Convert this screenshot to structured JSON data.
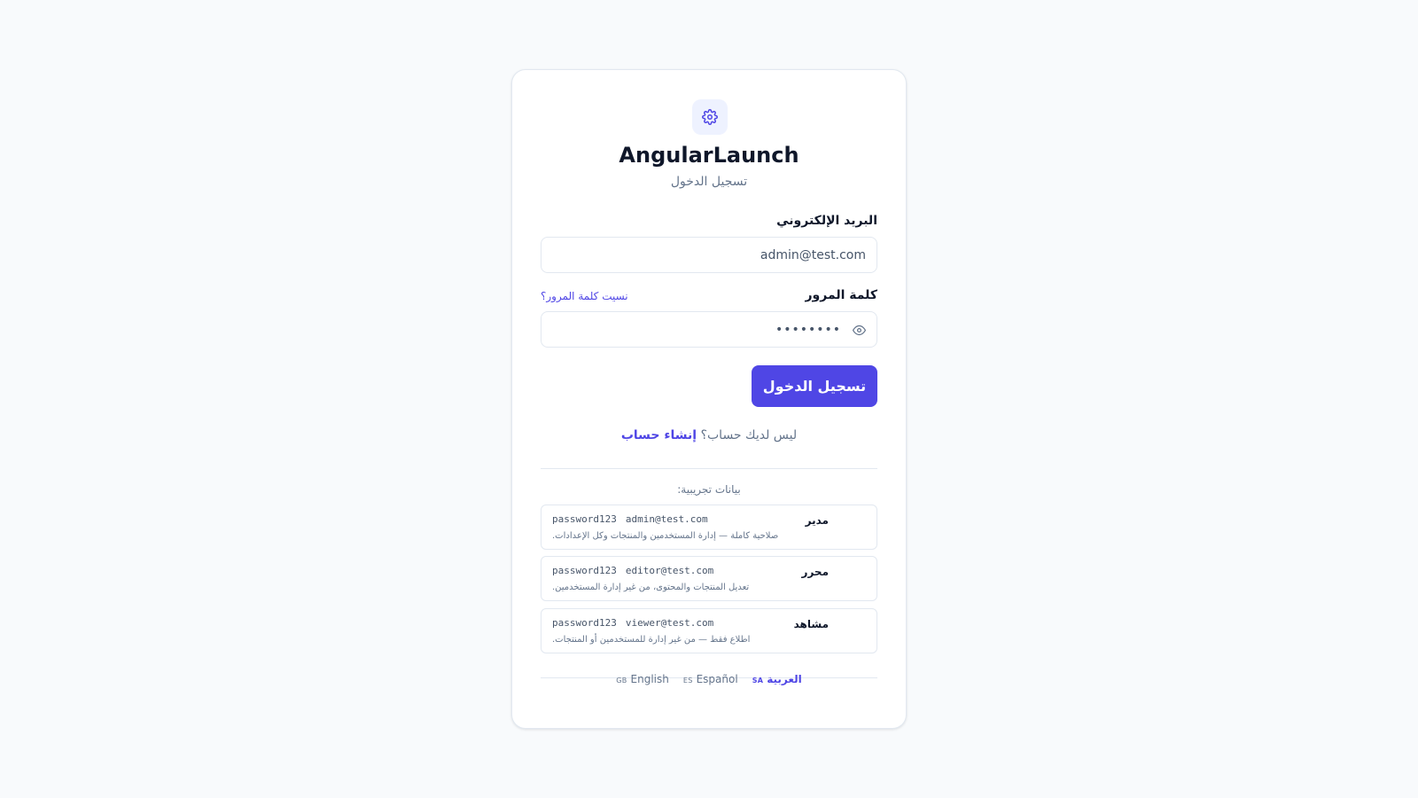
{
  "app": {
    "title": "AngularLaunch",
    "subtitle": "تسجيل الدخول",
    "logo_icon": "gear-icon",
    "accent_color": "#4f46e5"
  },
  "form": {
    "email_label": "البريد الإلكتروني",
    "email_value": "admin@test.com",
    "password_label": "كلمة المرور",
    "password_value": "password",
    "forgot_link": "نسيت كلمة المرور؟",
    "submit_label": "تسجيل الدخول"
  },
  "signup": {
    "prompt": "ليس لديك حساب؟",
    "link": "إنشاء حساب"
  },
  "demo": {
    "title": "بيانات تجريبية:",
    "accounts": [
      {
        "role": "مدير",
        "email": "admin@test.com",
        "password": "password123",
        "description": "صلاحية كاملة — إدارة المستخدمين والمنتجات وكل الإعدادات."
      },
      {
        "role": "محرر",
        "email": "editor@test.com",
        "password": "password123",
        "description": "تعديل المنتجات والمحتوى، من غير إدارة المستخدمين."
      },
      {
        "role": "مشاهد",
        "email": "viewer@test.com",
        "password": "password123",
        "description": "اطلاع فقط — من غير إدارة للمستخدمين أو المنتجات."
      }
    ]
  },
  "languages": [
    {
      "label": "العربية",
      "code": "SA",
      "active": true
    },
    {
      "label": "Español",
      "code": "ES",
      "active": false
    },
    {
      "label": "English",
      "code": "GB",
      "active": false
    }
  ]
}
